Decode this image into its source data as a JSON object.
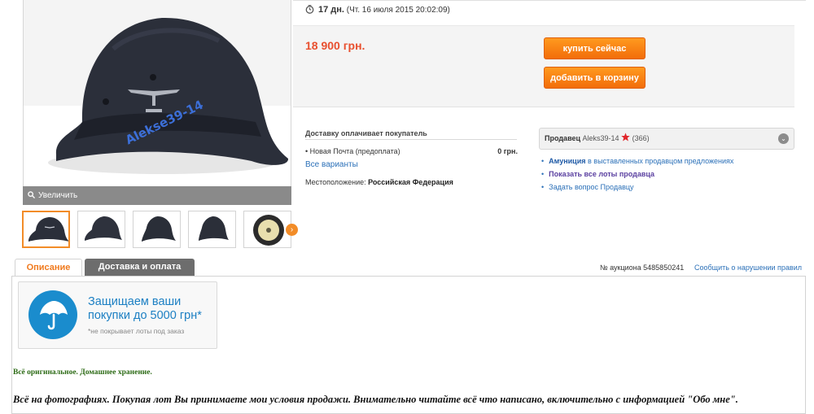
{
  "gallery": {
    "watermark": "Alekse39-14",
    "zoom_label": "Увеличить",
    "thumbnail_count": 5,
    "next_label": "›"
  },
  "timer": {
    "days": "17 дн.",
    "end_date": "(Чт. 16 июля 2015 20:02:09)"
  },
  "offer": {
    "price": "18 900 грн.",
    "buy_now_label": "купить сейчас",
    "add_to_cart_label": "добавить в корзину"
  },
  "delivery": {
    "title": "Доставку оплачивает покупатель",
    "method": "Новая Почта (предоплата)",
    "method_price": "0 грн.",
    "variants_link": "Все варианты",
    "location_label": "Местоположение:",
    "location_value": "Российская Федерация"
  },
  "seller": {
    "label": "Продавец",
    "name": "Aleks39-14",
    "rating": "(366)",
    "links": [
      {
        "bold": "Амуниция",
        "text": "в выставленных продавцом предложениях"
      },
      {
        "bold": "Показать все лоты продавца",
        "text": ""
      },
      {
        "bold": "",
        "text": "Задать вопрос Продавцу"
      }
    ]
  },
  "tabs": [
    {
      "label": "Описание",
      "active": true
    },
    {
      "label": "Доставка и оплата",
      "active": false
    }
  ],
  "auction": {
    "number": "№ аукциона 5485850241",
    "report_link": "Сообщить о нарушении правил"
  },
  "protection": {
    "title_line1": "Защищаем ваши",
    "title_line2": "покупки до 5000 грн*",
    "note": "*не покрывает лоты под заказ"
  },
  "description": {
    "line1": "Всё оригинальное.  Домашнее хранение.",
    "line2": "Всё на фотографиях. Покупая лот Вы принимаете мои условия продажи. Внимательно читайте всё что написано, включительно с информацией \"Обо мне\"."
  },
  "colors": {
    "accent": "#f28c28",
    "price": "#e8502f",
    "link": "#2b70b8",
    "protect_blue": "#1a8ccd"
  }
}
